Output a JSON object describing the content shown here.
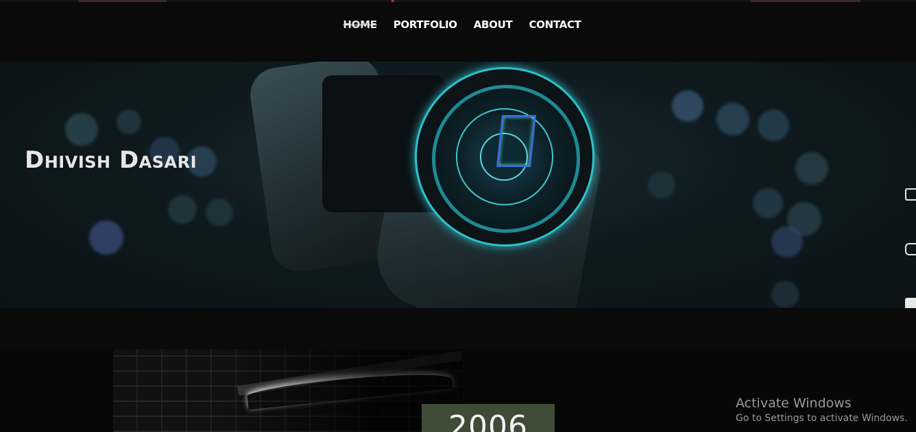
{
  "nav": {
    "items": [
      {
        "label": "HOME",
        "active": true
      },
      {
        "label": "PORTFOLIO",
        "active": false
      },
      {
        "label": "ABOUT",
        "active": false
      },
      {
        "label": "CONTACT",
        "active": false
      }
    ]
  },
  "hero": {
    "title": "Dhivish Dasari"
  },
  "social_icons": [
    "blog-icon",
    "instagram-icon",
    "dropdown-icon",
    "image-icon"
  ],
  "timeline": {
    "year": "2006"
  },
  "watermark": {
    "line1": "Activate Windows",
    "line2": "Go to Settings to activate Windows."
  },
  "colors": {
    "background": "#0a0a0a",
    "lens_accent": "#2fc1c9",
    "year_box": "#3d4b37",
    "highlight": "#c0233a"
  }
}
